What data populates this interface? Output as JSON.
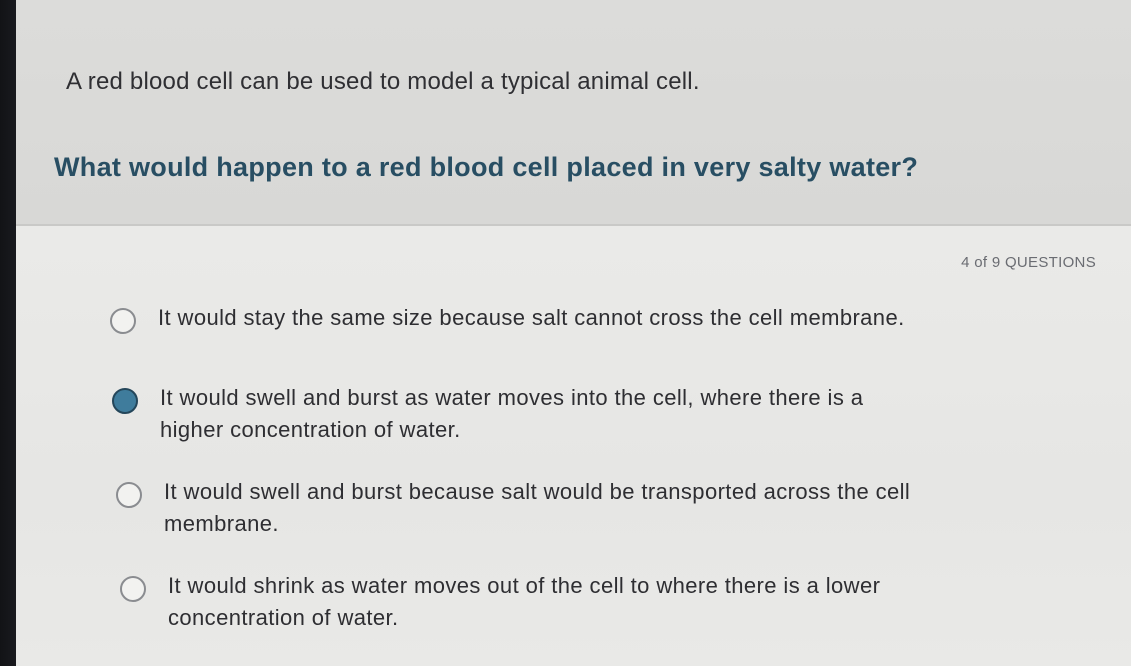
{
  "quiz": {
    "intro": "A red blood cell can be used to model a typical animal cell.",
    "question": "What would happen to a red blood cell placed in very salty water?",
    "progress": "4 of 9 QUESTIONS",
    "options": [
      {
        "line1": "It would stay the same size because salt cannot cross the cell membrane.",
        "line2": "",
        "selected": false
      },
      {
        "line1": "It would swell and burst as water moves into the cell, where there is a",
        "line2": "higher concentration of water.",
        "selected": true
      },
      {
        "line1": "It would swell and burst because salt would be transported across the cell",
        "line2": "membrane.",
        "selected": false
      },
      {
        "line1": "It would shrink as water moves out of the cell to where there is a lower",
        "line2": "concentration of water.",
        "selected": false
      }
    ]
  },
  "colors": {
    "question_text": "#284e63",
    "selected_radio": "#3f7c9c"
  }
}
